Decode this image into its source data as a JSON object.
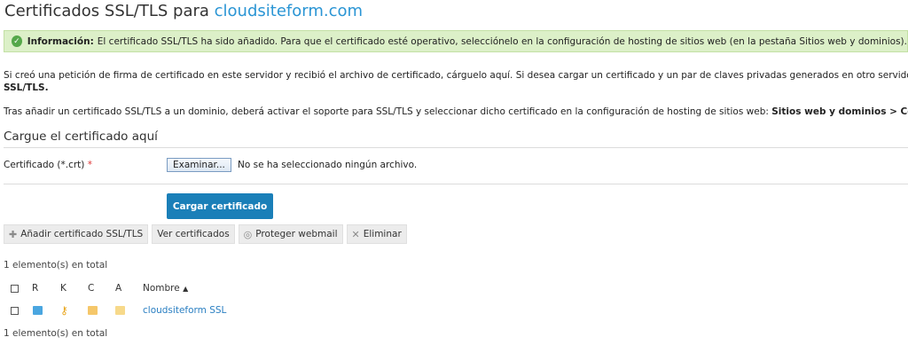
{
  "header": {
    "title_prefix": "Certificados SSL/TLS para",
    "title_domain": "cloudsiteform.com"
  },
  "alert": {
    "label": "Información:",
    "text": "El certificado SSL/TLS ha sido añadido. Para que el certificado esté operativo, selecciónelo en la configuración de hosting de sitios web (en la pestaña Sitios web y dominios)."
  },
  "intro": {
    "p1_line1": "Si creó una petición de firma de certificado en este servidor y recibió el archivo de certificado, cárguelo aquí. Si desea cargar un certificado y un par de claves privadas generados en otro servidor o",
    "p1_line2": "SSL/TLS.",
    "p2_text": "Tras añadir un certificado SSL/TLS a un dominio, deberá activar el soporte para SSL/TLS y seleccionar dicho certificado en la configuración de hosting de sitios web: ",
    "p2_bold": "Sitios web y dominios > Configu"
  },
  "upload": {
    "section_title": "Cargue el certificado aquí",
    "field_label": "Certificado (*.crt)",
    "required_mark": "*",
    "browse_label": "Examinar...",
    "no_file_text": "No se ha seleccionado ningún archivo.",
    "submit_label": "Cargar certificado"
  },
  "toolbar": {
    "add_label": "Añadir certificado SSL/TLS",
    "view_label": "Ver certificados",
    "protect_label": "Proteger webmail",
    "delete_label": "Eliminar"
  },
  "list": {
    "total_top": "1 elemento(s) en total",
    "total_bottom": "1 elemento(s) en total",
    "columns": [
      "R",
      "K",
      "C",
      "A",
      "Nombre"
    ],
    "sort_indicator": "▲",
    "rows": [
      {
        "name": "cloudsiteform SSL"
      }
    ]
  },
  "colors": {
    "accent": "#2a95d4",
    "primary_button": "#1a7fb8",
    "alert_bg": "#dcf0c8",
    "alert_icon": "#55a84a"
  }
}
